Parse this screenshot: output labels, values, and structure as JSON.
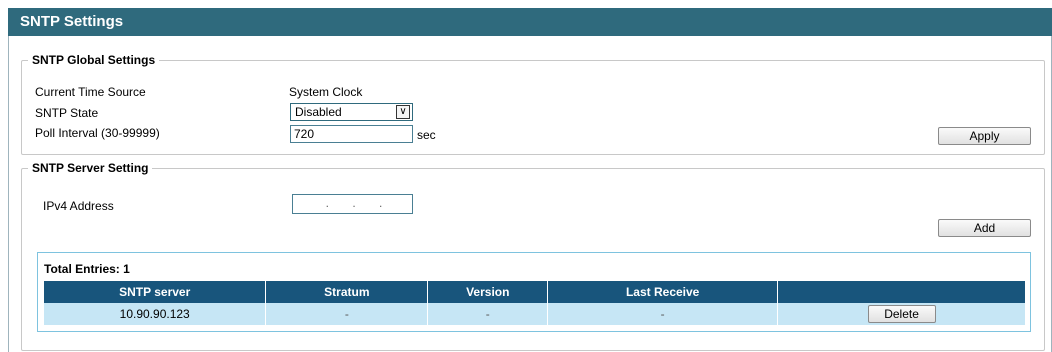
{
  "page": {
    "title": "SNTP Settings"
  },
  "global": {
    "legend": "SNTP Global Settings",
    "time_source_label": "Current Time Source",
    "time_source_value": "System Clock",
    "state_label": "SNTP State",
    "state_value": "Disabled",
    "state_arrow": "∨",
    "poll_label": "Poll Interval (30-99999)",
    "poll_value": "720",
    "poll_unit": "sec",
    "apply_label": "Apply"
  },
  "server": {
    "legend": "SNTP Server Setting",
    "ipv4_label": "IPv4 Address",
    "ipv4_dots": ".       .       .",
    "add_label": "Add"
  },
  "table": {
    "total_label": "Total Entries: 1",
    "headers": [
      "SNTP server",
      "Stratum",
      "Version",
      "Last Receive",
      ""
    ],
    "rows": [
      {
        "server": "10.90.90.123",
        "stratum": "-",
        "version": "-",
        "last_receive": "-",
        "action": "Delete"
      }
    ]
  }
}
